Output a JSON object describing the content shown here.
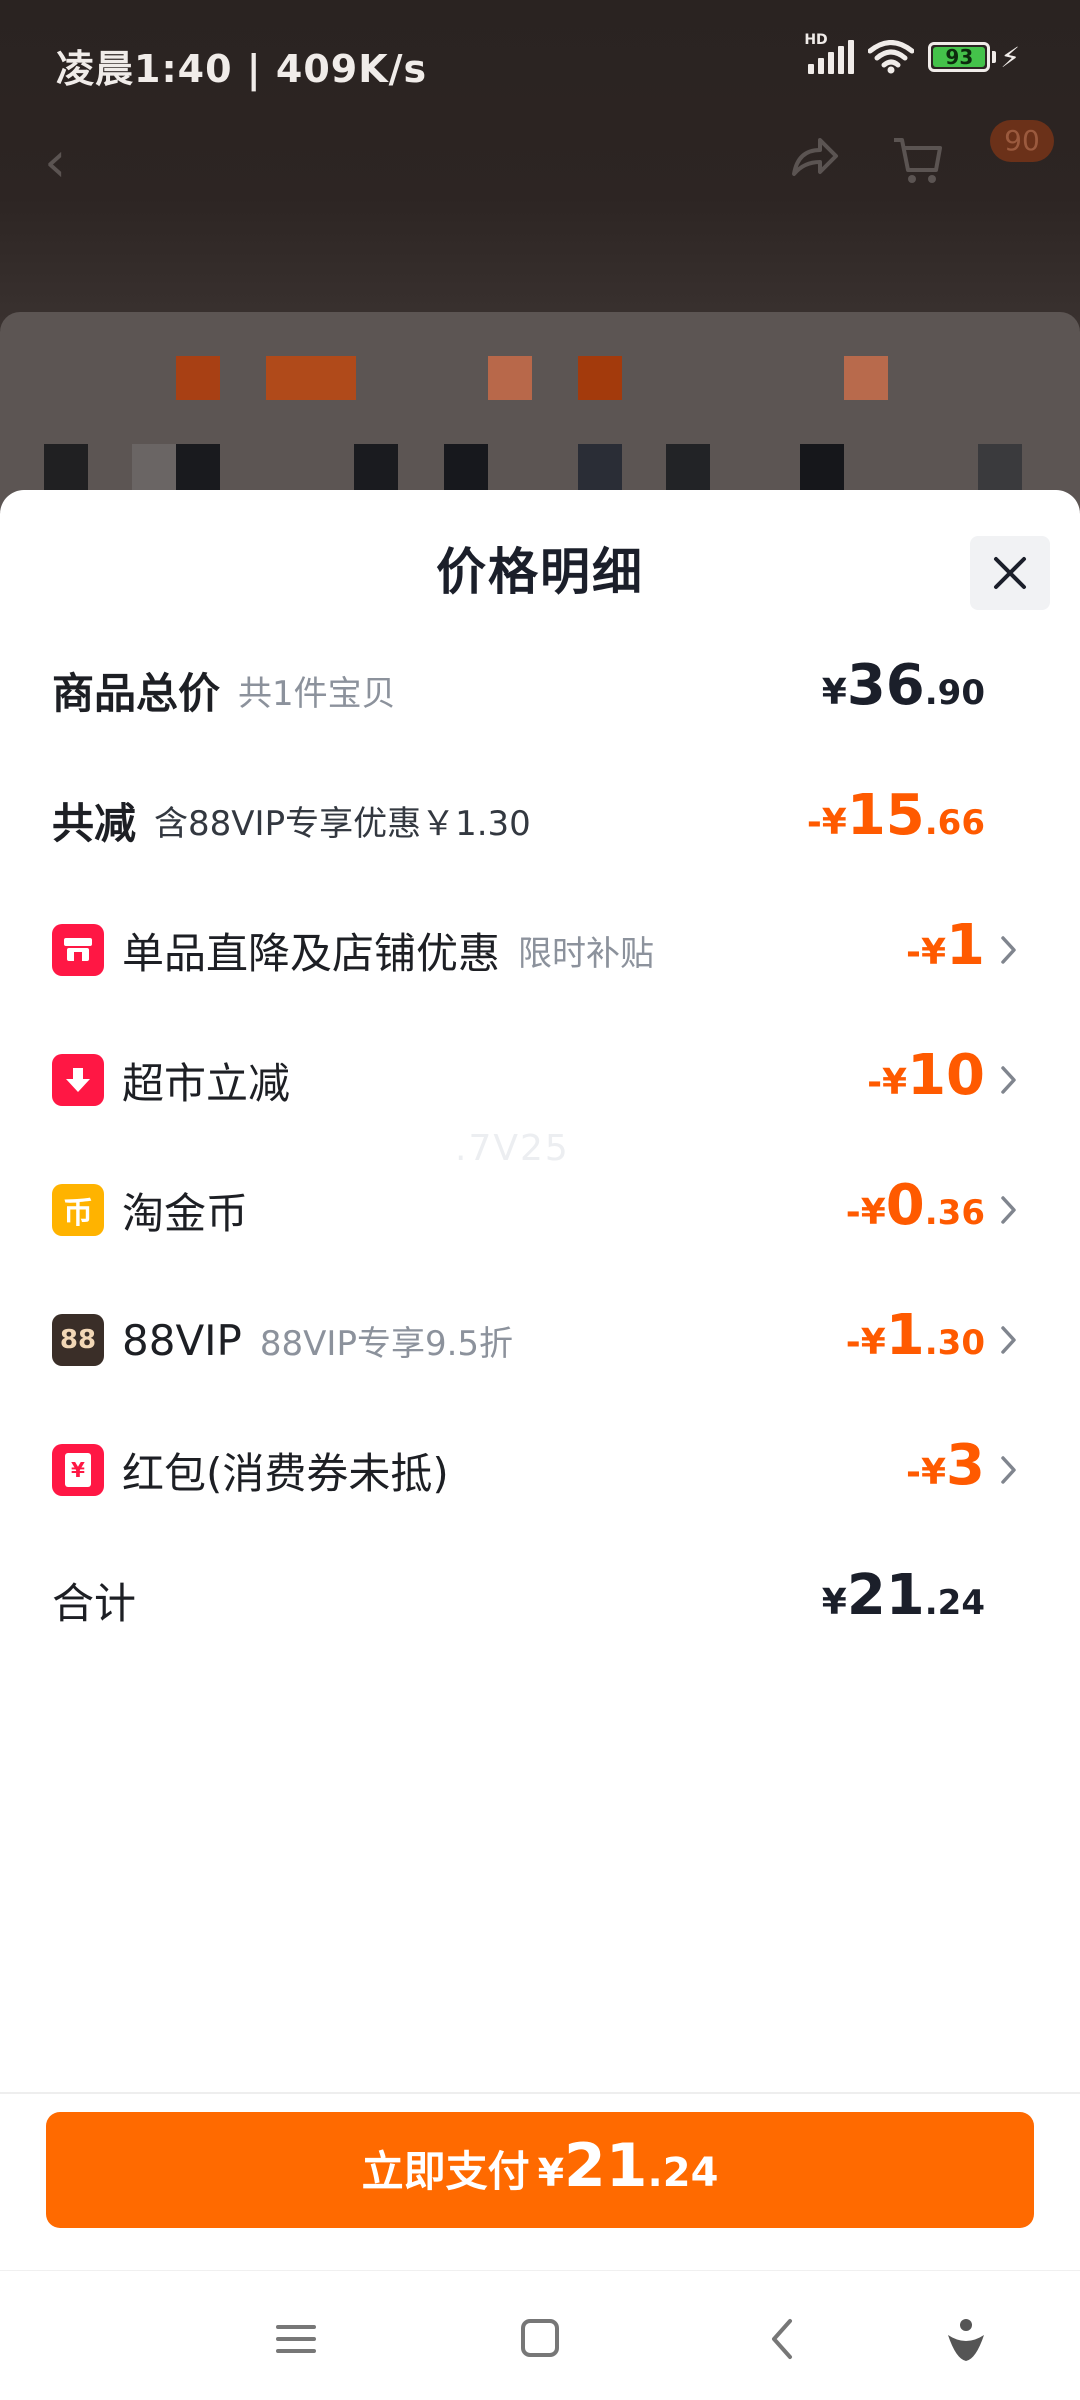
{
  "status_bar": {
    "time": "凌晨1:40",
    "speed": "409K/s",
    "network": "HD",
    "battery": "93"
  },
  "background_nav": {
    "cart_badge": "90"
  },
  "sheet": {
    "title": "价格明细",
    "rows": [
      {
        "label": "商品总价",
        "sub": "共1件宝贝",
        "yen": "¥",
        "int": "36",
        "dec": ".90",
        "color": "black",
        "icon": null,
        "chevron": false
      },
      {
        "label": "共减",
        "sub": "含88VIP专享优惠￥1.30",
        "yen": "-¥",
        "int": "15",
        "dec": ".66",
        "color": "orange",
        "icon": null,
        "chevron": false
      },
      {
        "label": "单品直降及店铺优惠",
        "sub": "限时补贴",
        "yen": "-¥",
        "int": "1",
        "dec": "",
        "color": "orange",
        "icon": "shop-icon",
        "chevron": true
      },
      {
        "label": "超市立减",
        "sub": "",
        "yen": "-¥",
        "int": "10",
        "dec": "",
        "color": "orange",
        "icon": "down-arrow-icon",
        "chevron": true
      },
      {
        "label": "淘金币",
        "sub": "",
        "yen": "-¥",
        "int": "0",
        "dec": ".36",
        "color": "orange",
        "icon": "coin-icon",
        "chevron": true
      },
      {
        "label": "88VIP",
        "sub": "88VIP专享9.5折",
        "yen": "-¥",
        "int": "1",
        "dec": ".30",
        "color": "orange",
        "icon": "vip88-icon",
        "chevron": true
      },
      {
        "label": "红包(消费券未抵)",
        "sub": "",
        "yen": "-¥",
        "int": "3",
        "dec": "",
        "color": "orange",
        "icon": "red-packet-icon",
        "chevron": true
      },
      {
        "label": "合计",
        "sub": "",
        "yen": "¥",
        "int": "21",
        "dec": ".24",
        "color": "black",
        "icon": null,
        "chevron": false
      }
    ],
    "icon_texts": {
      "coin": "币",
      "vip": "88",
      "packet": "¥"
    },
    "watermark": ".7V25"
  },
  "pay": {
    "label": "立即支付",
    "yen": "¥",
    "int": "21",
    "dec": ".24"
  },
  "colors": {
    "accent": "#ff6a00",
    "discount": "#ff5a00",
    "icon_red": "#ff1744",
    "icon_gold": "#ffb300",
    "icon_vip": "#3a2e28"
  }
}
